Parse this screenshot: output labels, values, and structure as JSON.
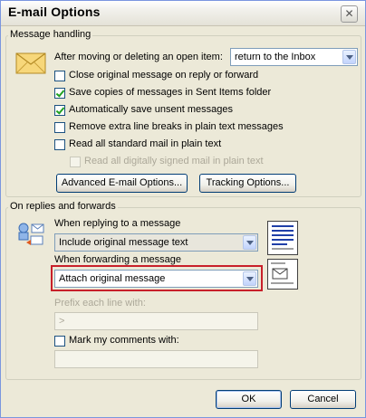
{
  "window": {
    "title": "E-mail Options",
    "close_glyph": "✕"
  },
  "message_handling": {
    "legend": "Message handling",
    "after_moving_label": "After moving or deleting an open item:",
    "after_moving_value": "return to the Inbox",
    "options": [
      {
        "label": "Close original message on reply or forward",
        "checked": false,
        "enabled": true
      },
      {
        "label": "Save copies of messages in Sent Items folder",
        "checked": true,
        "enabled": true
      },
      {
        "label": "Automatically save unsent messages",
        "checked": true,
        "enabled": true
      },
      {
        "label": "Remove extra line breaks in plain text messages",
        "checked": false,
        "enabled": true
      },
      {
        "label": "Read all standard mail in plain text",
        "checked": false,
        "enabled": true
      },
      {
        "label": "Read all digitally signed mail in plain text",
        "checked": false,
        "enabled": false
      }
    ],
    "advanced_button": "Advanced E-mail Options...",
    "tracking_button": "Tracking Options..."
  },
  "replies_forwards": {
    "legend": "On replies and forwards",
    "reply_label": "When replying to a message",
    "reply_value": "Include original message text",
    "forward_label": "When forwarding a message",
    "forward_value": "Attach original message",
    "prefix_label": "Prefix each line with:",
    "prefix_value": ">",
    "mark_comments_label": "Mark my comments with:",
    "mark_comments_checked": false,
    "mark_comments_value": ""
  },
  "footer": {
    "ok": "OK",
    "cancel": "Cancel"
  },
  "colors": {
    "highlight": "#C8202A",
    "window_bg": "#ECE9D8",
    "check": "#21A121"
  }
}
